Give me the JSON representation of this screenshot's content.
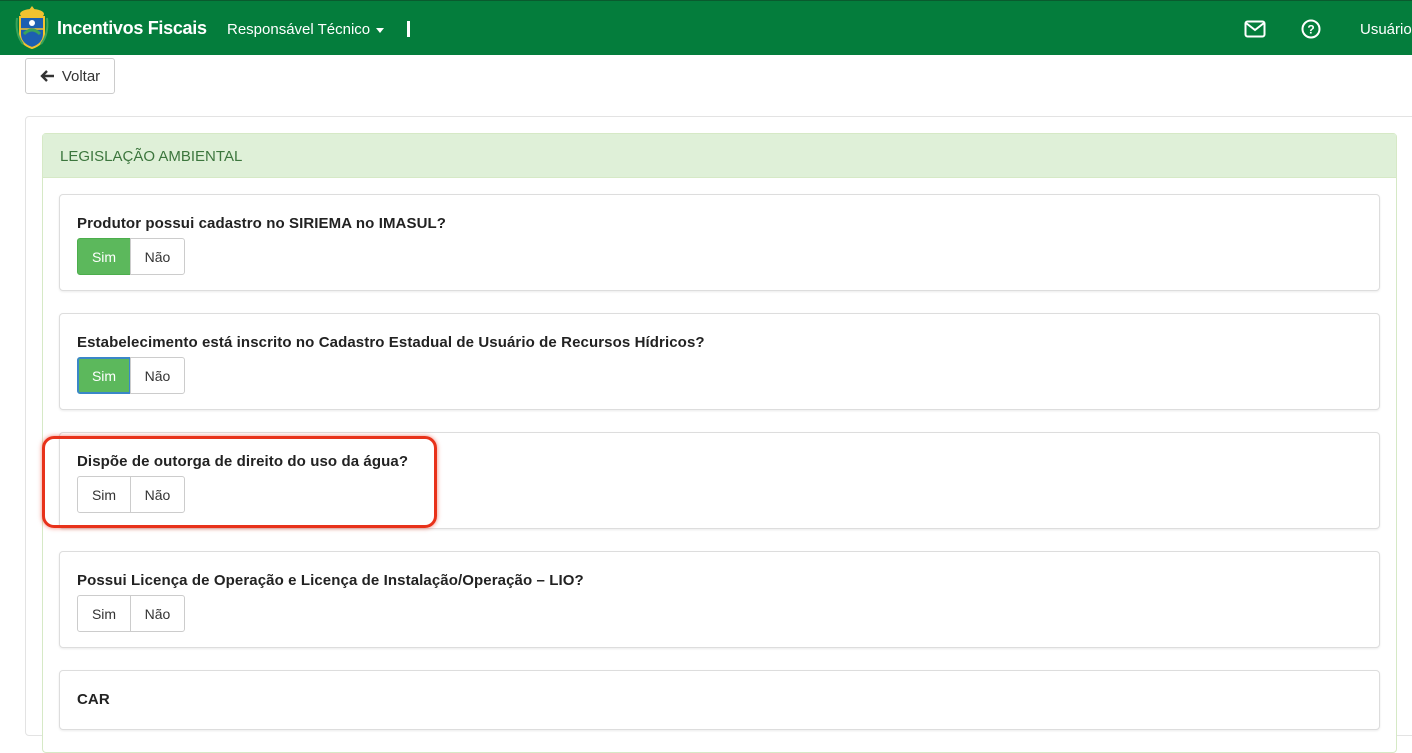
{
  "navbar": {
    "brand": "Incentivos Fiscais",
    "menu_label": "Responsável Técnico",
    "separator": "I",
    "user_label": "Usuário",
    "icons": [
      "crest-logo-icon",
      "mail-icon",
      "help-icon",
      "caret-down-icon"
    ],
    "bg_color": "#047d3c"
  },
  "back_button": {
    "label": "Voltar",
    "icon": "arrow-left-icon"
  },
  "section": {
    "title": "LEGISLAÇÃO AMBIENTAL",
    "questions": [
      {
        "label": "Produtor possui cadastro no SIRIEMA no IMASUL?",
        "yes": "Sim",
        "no": "Não",
        "selected": "Sim"
      },
      {
        "label": "Estabelecimento está inscrito no Cadastro Estadual de Usuário de Recursos Hídricos?",
        "yes": "Sim",
        "no": "Não",
        "selected": "Sim"
      },
      {
        "label": "Dispõe de outorga de direito do uso da água?",
        "yes": "Sim",
        "no": "Não",
        "selected": ""
      },
      {
        "label": "Possui Licença de Operação e Licença de Instalação/Operação – LIO?",
        "yes": "Sim",
        "no": "Não",
        "selected": ""
      },
      {
        "label": "CAR"
      }
    ]
  },
  "colors": {
    "selected_green": "#5cb85c",
    "panel_header_bg": "#dff0d8",
    "panel_header_text": "#3c763d",
    "highlight_red": "#e8321a"
  }
}
